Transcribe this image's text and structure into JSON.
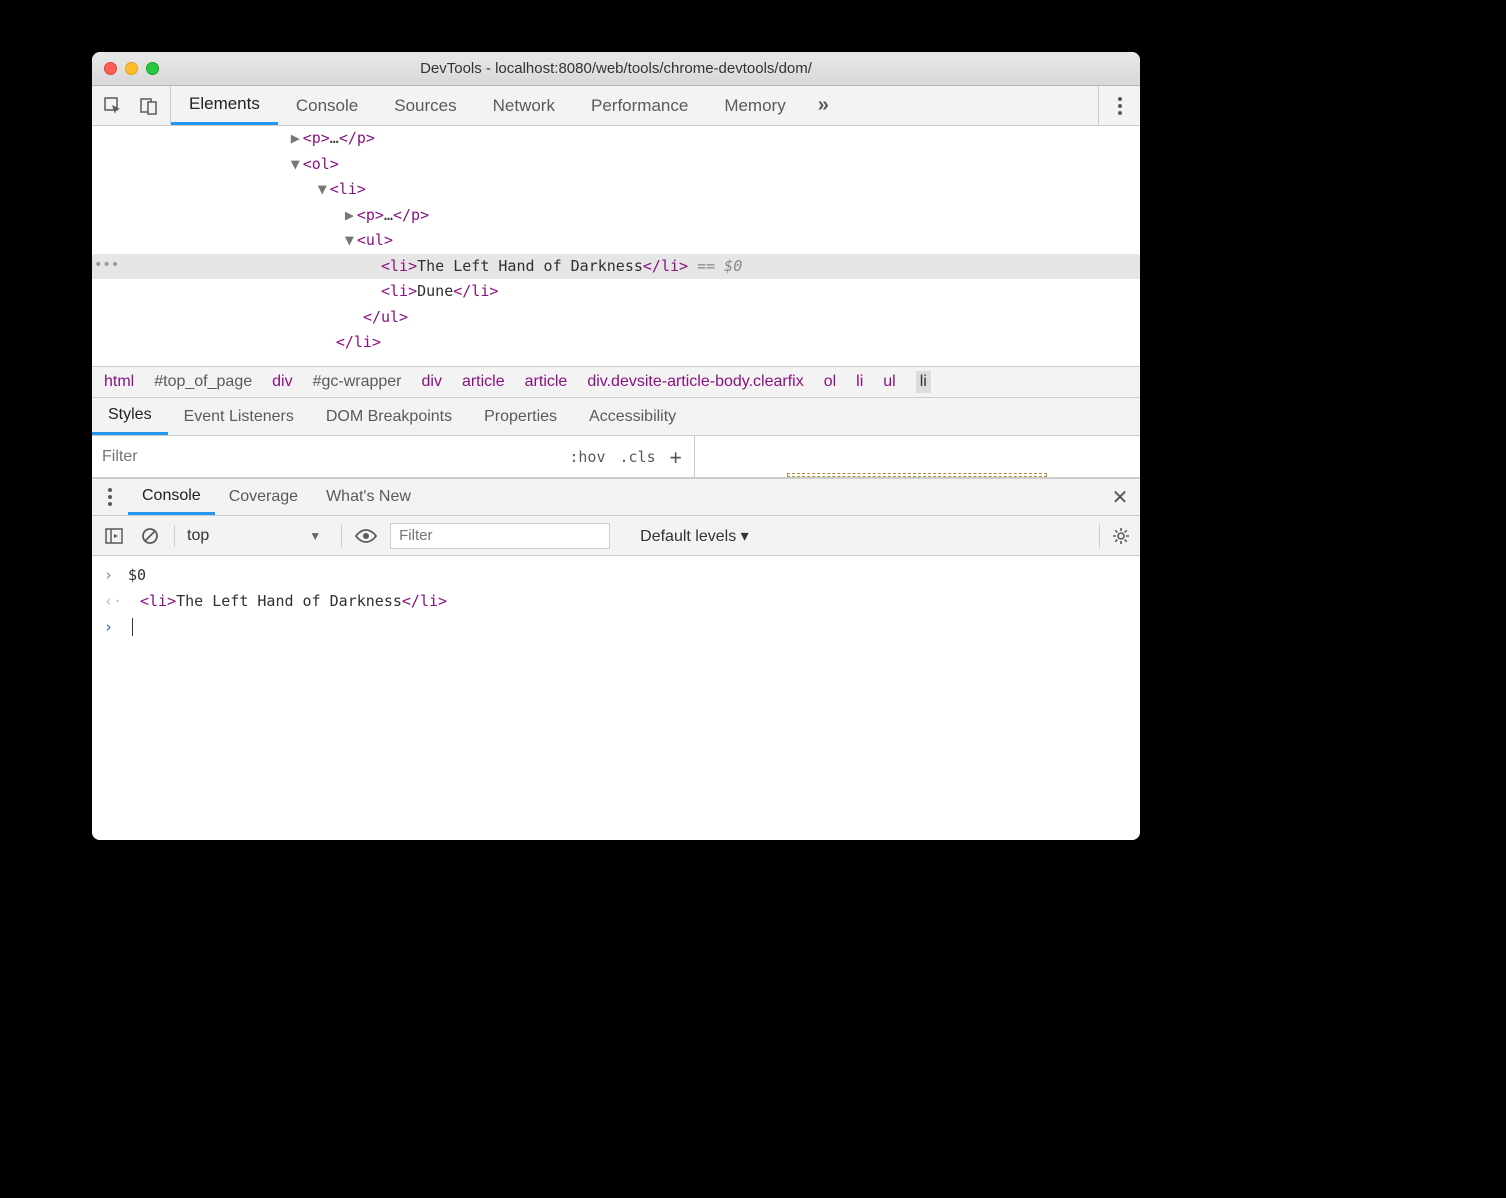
{
  "window": {
    "title": "DevTools - localhost:8080/web/tools/chrome-devtools/dom/"
  },
  "main_tabs": [
    "Elements",
    "Console",
    "Sources",
    "Network",
    "Performance",
    "Memory"
  ],
  "main_tabs_active": 0,
  "more_glyph": "»",
  "dom_tree": {
    "lines": [
      {
        "indent": 160,
        "arrow": "▶",
        "open": "<p>",
        "text": "…",
        "close": "</p>"
      },
      {
        "indent": 160,
        "arrow": "▼",
        "open": "<ol>",
        "text": "",
        "close": ""
      },
      {
        "indent": 180,
        "arrow": "▼",
        "open": "<li>",
        "text": "",
        "close": ""
      },
      {
        "indent": 200,
        "arrow": "▶",
        "open": "<p>",
        "text": "…",
        "close": "</p>"
      },
      {
        "indent": 200,
        "arrow": "▼",
        "open": "<ul>",
        "text": "",
        "close": ""
      },
      {
        "indent": 230,
        "arrow": "",
        "open": "<li>",
        "text": "The Left Hand of Darkness",
        "close": "</li>",
        "selected": true,
        "suffix": " == $0"
      },
      {
        "indent": 230,
        "arrow": "",
        "open": "<li>",
        "text": "Dune",
        "close": "</li>"
      },
      {
        "indent": 210,
        "arrow": "",
        "open": "",
        "text": "",
        "close": "</ul>"
      },
      {
        "indent": 190,
        "arrow": "",
        "open": "",
        "text": "",
        "close": "</li>"
      }
    ]
  },
  "breadcrumb": [
    {
      "t": "html",
      "cls": ""
    },
    {
      "t": "#top_of_page",
      "cls": "gray"
    },
    {
      "t": "div",
      "cls": ""
    },
    {
      "t": "#gc-wrapper",
      "cls": "gray"
    },
    {
      "t": "div",
      "cls": ""
    },
    {
      "t": "article",
      "cls": ""
    },
    {
      "t": "article",
      "cls": ""
    },
    {
      "t": "div.devsite-article-body.clearfix",
      "cls": ""
    },
    {
      "t": "ol",
      "cls": ""
    },
    {
      "t": "li",
      "cls": ""
    },
    {
      "t": "ul",
      "cls": ""
    },
    {
      "t": "li",
      "cls": "sel"
    }
  ],
  "styles_tabs": [
    "Styles",
    "Event Listeners",
    "DOM Breakpoints",
    "Properties",
    "Accessibility"
  ],
  "styles_tabs_active": 0,
  "filter": {
    "placeholder": "Filter",
    "hov": ":hov",
    "cls": ".cls",
    "plus": "+"
  },
  "drawer_tabs": [
    "Console",
    "Coverage",
    "What's New"
  ],
  "drawer_tabs_active": 0,
  "console_toolbar": {
    "context": "top",
    "filter_placeholder": "Filter",
    "levels": "Default levels ▾"
  },
  "console": {
    "input": "$0",
    "output_open": "<li>",
    "output_text": "The Left Hand of Darkness",
    "output_close": "</li>"
  }
}
